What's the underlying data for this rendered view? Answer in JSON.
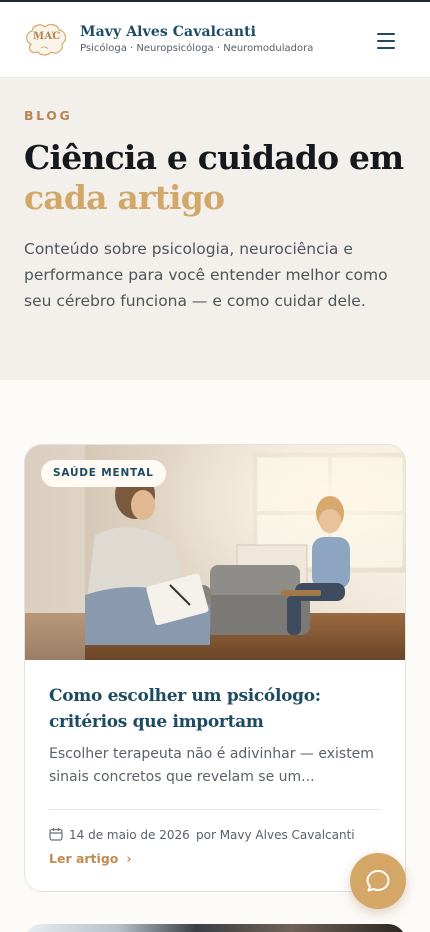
{
  "header": {
    "logo_text": "MAC",
    "brand_name": "Mavy Alves Cavalcanti",
    "brand_subtitle": "Psicóloga · Neuropsicóloga · Neuromoduladora",
    "menu_icon": "hamburger-menu-icon"
  },
  "hero": {
    "eyebrow": "BLOG",
    "title_line1": "Ciência e cuidado em",
    "title_line2": "cada artigo",
    "description": "Conteúdo sobre psicologia, neurociência e performance para você entender melhor como seu cérebro funciona — e como cuidar dele."
  },
  "articles": [
    {
      "tag": "SAÚDE MENTAL",
      "title": "Como escolher um psicólogo: critérios que importam",
      "excerpt": "Escolher terapeuta não é adivinhar — existem sinais concretos que revelam se um...",
      "date": "14 de maio de 2026",
      "author": "por Mavy Alves Cavalcanti",
      "link_label": "Ler artigo",
      "link_icon": "chevron-right-icon",
      "date_icon": "calendar-icon"
    }
  ],
  "chat": {
    "icon": "chat-bubble-icon"
  },
  "colors": {
    "brand_blue": "#1c4b63",
    "accent_gold": "#d2a86a",
    "link_copper": "#c18a52",
    "hero_bg": "#f3efea"
  }
}
